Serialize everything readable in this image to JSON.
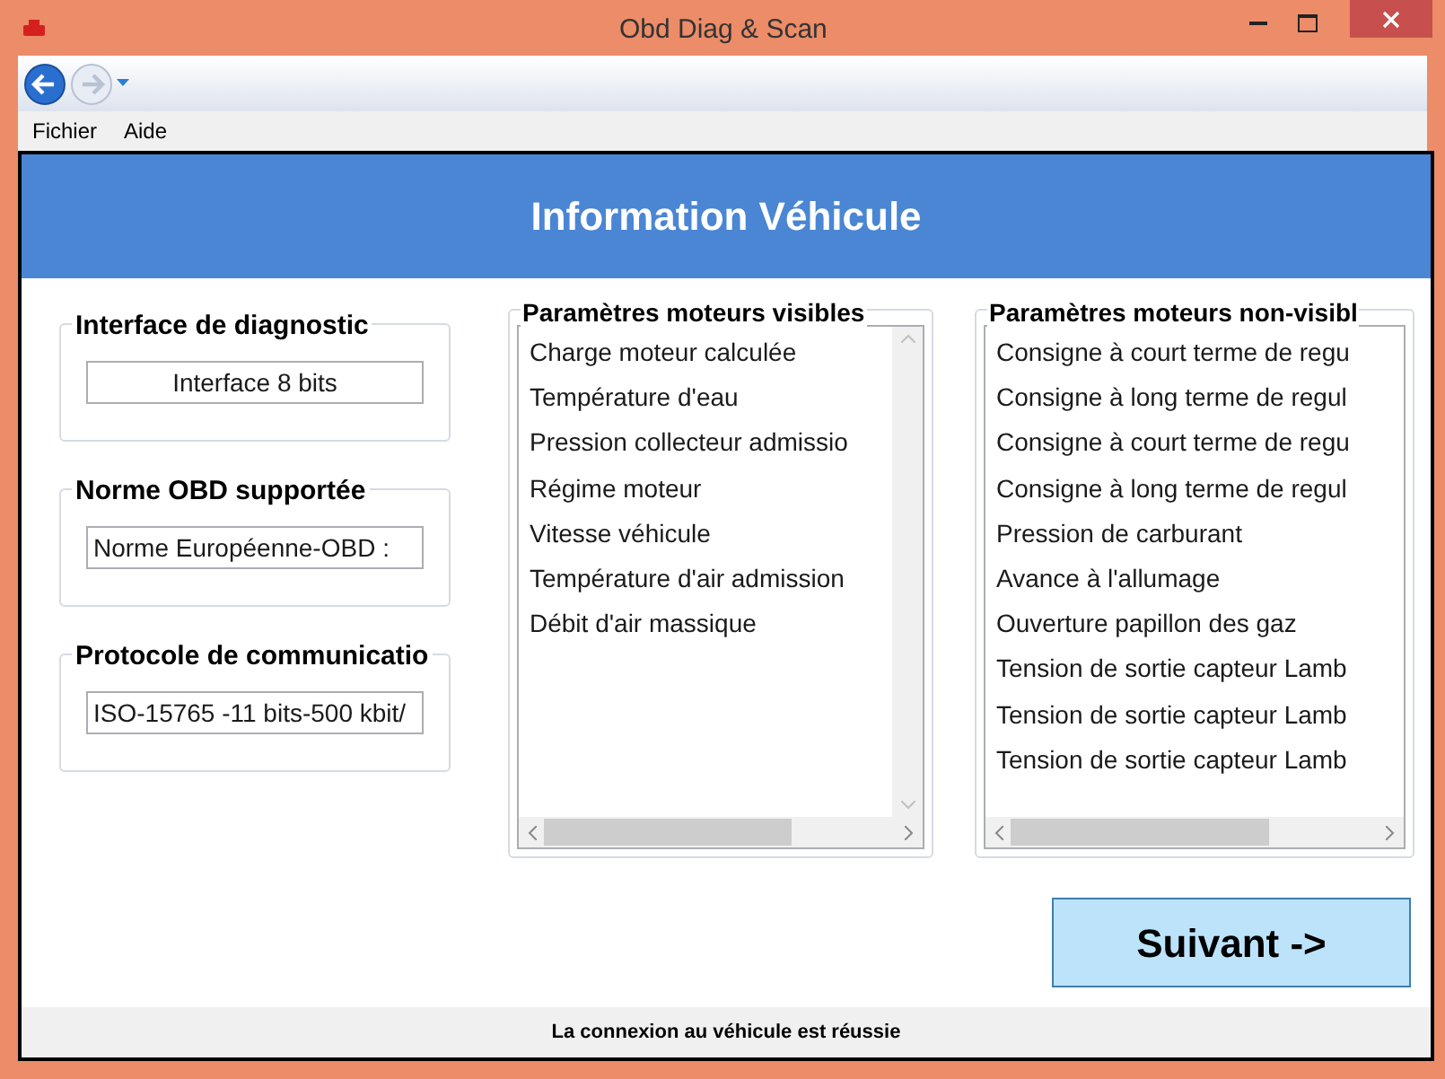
{
  "window": {
    "title": "Obd Diag & Scan"
  },
  "menu": [
    "Fichier",
    "Aide"
  ],
  "header": {
    "title": "Information Véhicule"
  },
  "groups": [
    {
      "label": "Interface de diagnostic",
      "value": "Interface 8 bits",
      "centered": true
    },
    {
      "label": "Norme OBD supportée",
      "value": "Norme Européenne-OBD :",
      "centered": false
    },
    {
      "label": "Protocole de communicatio",
      "value": "ISO-15765 -11 bits-500 kbit/",
      "centered": false
    }
  ],
  "lists": [
    {
      "label": "Paramètres moteurs visibles",
      "vertical_scrollbar": true,
      "items": [
        "Charge moteur calculée",
        "Température d'eau",
        "Pression collecteur admissio",
        "Régime moteur",
        "Vitesse véhicule",
        "Température d'air admission",
        "Débit d'air massique"
      ]
    },
    {
      "label": "Paramètres moteurs non-visibl",
      "vertical_scrollbar": false,
      "items": [
        "Consigne à court terme de regu",
        "Consigne à long terme de regul",
        "Consigne à court terme de regu",
        "Consigne à long terme de regul",
        "Pression de carburant",
        "Avance à l'allumage",
        "Ouverture papillon des gaz",
        "Tension de sortie capteur Lamb",
        "Tension de sortie capteur Lamb",
        "Tension de sortie capteur Lamb"
      ]
    }
  ],
  "next_button": "Suivant ->",
  "status_bar": "La connexion au véhicule est réussie"
}
